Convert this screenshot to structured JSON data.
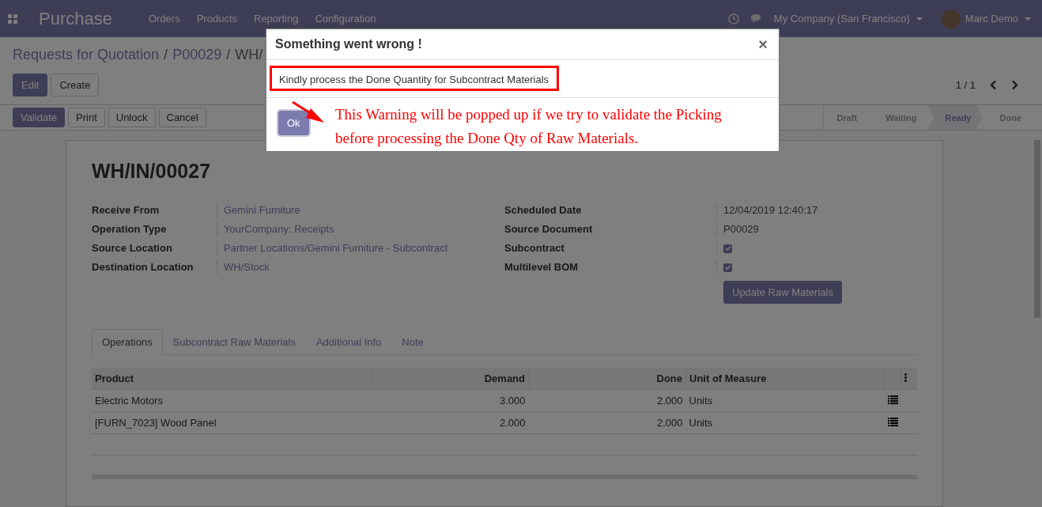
{
  "navbar": {
    "brand": "Purchase",
    "menu": [
      "Orders",
      "Products",
      "Reporting",
      "Configuration"
    ],
    "company": "My Company (San Francisco)",
    "user": "Marc Demo"
  },
  "breadcrumbs": [
    "Requests for Quotation",
    "P00029",
    "WH/"
  ],
  "breadcrumb_separator": "/",
  "form_buttons": [
    "Edit",
    "Create"
  ],
  "pager": "1 / 1",
  "action_buttons": [
    {
      "label": "Validate",
      "kind": "primary"
    },
    {
      "label": "Print",
      "kind": "secondary"
    },
    {
      "label": "Unlock",
      "kind": "secondary"
    },
    {
      "label": "Cancel",
      "kind": "secondary"
    }
  ],
  "stages": [
    {
      "label": "Draft",
      "selected": false
    },
    {
      "label": "Waiting",
      "selected": false
    },
    {
      "label": "Ready",
      "selected": true
    },
    {
      "label": "Done",
      "selected": false
    }
  ],
  "record": {
    "title": "WH/IN/00027",
    "left_fields": [
      {
        "label": "Receive From",
        "value": "Gemini Furniture",
        "kind": "link"
      },
      {
        "label": "Operation Type",
        "value": "YourCompany: Receipts",
        "kind": "link"
      },
      {
        "label": "Source Location",
        "value": "Partner Locations/Gemini Furniture - Subcontract",
        "kind": "link"
      },
      {
        "label": "Destination Location",
        "value": "WH/Stock",
        "kind": "link"
      }
    ],
    "right_fields": [
      {
        "label": "Scheduled Date",
        "value": "12/04/2019 12:40:17",
        "kind": "text"
      },
      {
        "label": "Source Document",
        "value": "P00029",
        "kind": "text"
      },
      {
        "label": "Subcontract",
        "checked": true,
        "kind": "checkbox"
      },
      {
        "label": "Multilevel BOM",
        "checked": true,
        "kind": "checkbox"
      }
    ],
    "update_button": "Update Raw Materials"
  },
  "tabs": [
    {
      "label": "Operations",
      "selected": true
    },
    {
      "label": "Subcontract Raw Materials",
      "selected": false
    },
    {
      "label": "Additional Info",
      "selected": false
    },
    {
      "label": "Note",
      "selected": false
    }
  ],
  "table": {
    "columns": [
      "Product",
      "Demand",
      "Done",
      "Unit of Measure"
    ],
    "rows": [
      [
        "Electric Motors",
        "3.000",
        "2.000",
        "Units"
      ],
      [
        "[FURN_7023] Wood Panel",
        "2.000",
        "2.000",
        "Units"
      ]
    ]
  },
  "dialog": {
    "title": "Something went wrong !",
    "close": "×",
    "message": "Kindly process the Done Quantity for Subcontract Materials",
    "button": "Ok"
  },
  "annotation": {
    "lines": [
      "This Warning will be popped up if we try to validate the Picking",
      "before processing the Done Qty of Raw Materials."
    ]
  }
}
